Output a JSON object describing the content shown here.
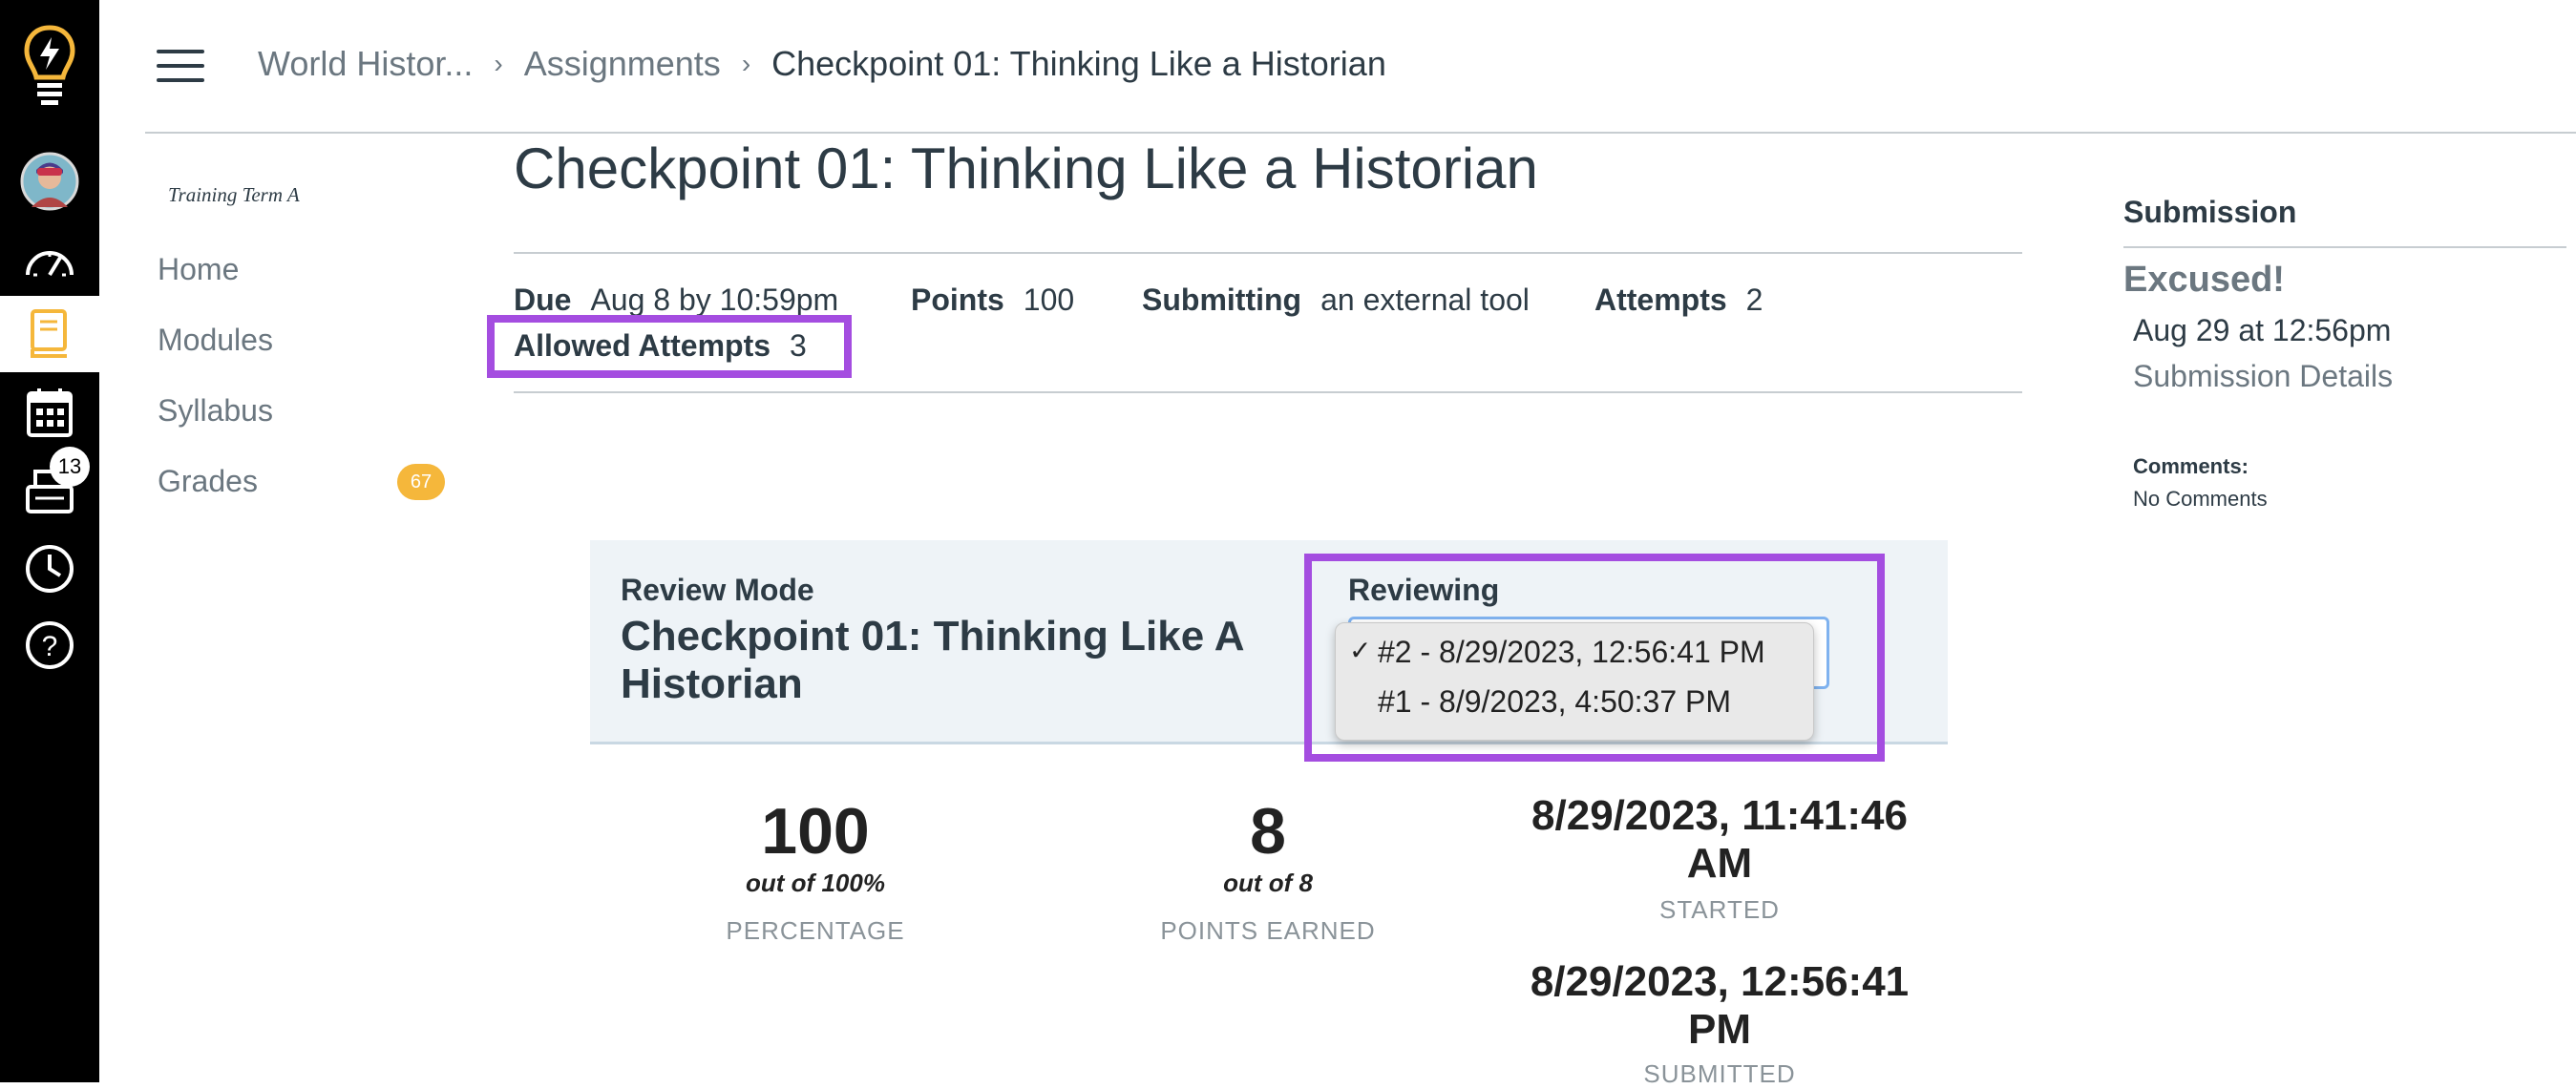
{
  "global_nav": {
    "inbox_badge": "13",
    "icons": [
      "lightbulb-logo-icon",
      "account-avatar",
      "dashboard-icon",
      "courses-icon",
      "calendar-icon",
      "inbox-icon",
      "history-icon",
      "help-icon"
    ]
  },
  "breadcrumb": {
    "course": "World Histor...",
    "section": "Assignments",
    "current": "Checkpoint 01: Thinking Like a Historian"
  },
  "course_nav": {
    "term": "Training Term A",
    "items": [
      {
        "label": "Home"
      },
      {
        "label": "Modules"
      },
      {
        "label": "Syllabus"
      },
      {
        "label": "Grades",
        "badge": "67"
      }
    ]
  },
  "assignment": {
    "title": "Checkpoint 01: Thinking Like a Historian",
    "due_label": "Due",
    "due_value": "Aug 8 by 10:59pm",
    "points_label": "Points",
    "points_value": "100",
    "submitting_label": "Submitting",
    "submitting_value": "an external tool",
    "attempts_label": "Attempts",
    "attempts_value": "2",
    "allowed_attempts_label": "Allowed Attempts",
    "allowed_attempts_value": "3"
  },
  "submission": {
    "heading": "Submission",
    "status": "Excused!",
    "date": "Aug 29 at 12:56pm",
    "details_link": "Submission Details",
    "comments_label": "Comments:",
    "comments_value": "No Comments"
  },
  "review": {
    "mode_label": "Review Mode",
    "title": "Checkpoint 01: Thinking Like A Historian",
    "reviewing_label": "Reviewing",
    "options": [
      {
        "label": "#2 - 8/29/2023, 12:56:41 PM",
        "selected": true
      },
      {
        "label": "#1 - 8/9/2023, 4:50:37 PM",
        "selected": false
      }
    ]
  },
  "stats": {
    "percentage": {
      "value": "100",
      "sub": "out of 100%",
      "label": "PERCENTAGE"
    },
    "points": {
      "value": "8",
      "sub": "out of 8",
      "label": "POINTS EARNED"
    },
    "started": {
      "value": "8/29/2023, 11:41:46 AM",
      "label": "STARTED"
    },
    "submitted": {
      "value": "8/29/2023, 12:56:41 PM",
      "label": "SUBMITTED"
    }
  },
  "colors": {
    "highlight": "#a44de0",
    "courses_active": "#f5b73b",
    "badge": "#f5b73b"
  }
}
